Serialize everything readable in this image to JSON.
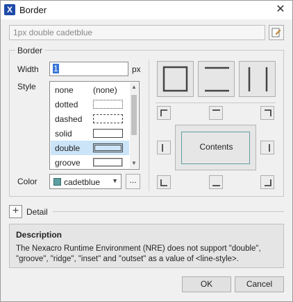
{
  "window": {
    "title": "Border",
    "app_icon": "nexacro-x-icon",
    "close_icon": "close-icon"
  },
  "summary": {
    "value": "1px double cadetblue",
    "button_icon": "edit-document-icon"
  },
  "border_group": {
    "label": "Border",
    "width_label": "Width",
    "width_value": "1",
    "width_unit": "px",
    "style_label": "Style",
    "styles": [
      {
        "name": "none",
        "sample": "(none)"
      },
      {
        "name": "dotted",
        "sample": "dotted"
      },
      {
        "name": "dashed",
        "sample": "dashed"
      },
      {
        "name": "solid",
        "sample": "solid"
      },
      {
        "name": "double",
        "sample": "double",
        "selected": true
      },
      {
        "name": "groove",
        "sample": "groove"
      }
    ],
    "style_samples_none_text": "(none)",
    "color_label": "Color",
    "color_value": "cadetblue",
    "color_hex": "#5f9ea0",
    "color_more": "...",
    "preview_text": "Contents"
  },
  "detail": {
    "label": "Detail",
    "toggle_icon": "plus-icon"
  },
  "description": {
    "title": "Description",
    "text": "The Nexacro Runtime Environment (NRE) does not support \"double\", \"groove\", \"ridge\", \"inset\" and \"outset\" as a value of <line-style>."
  },
  "buttons": {
    "ok": "OK",
    "cancel": "Cancel"
  }
}
